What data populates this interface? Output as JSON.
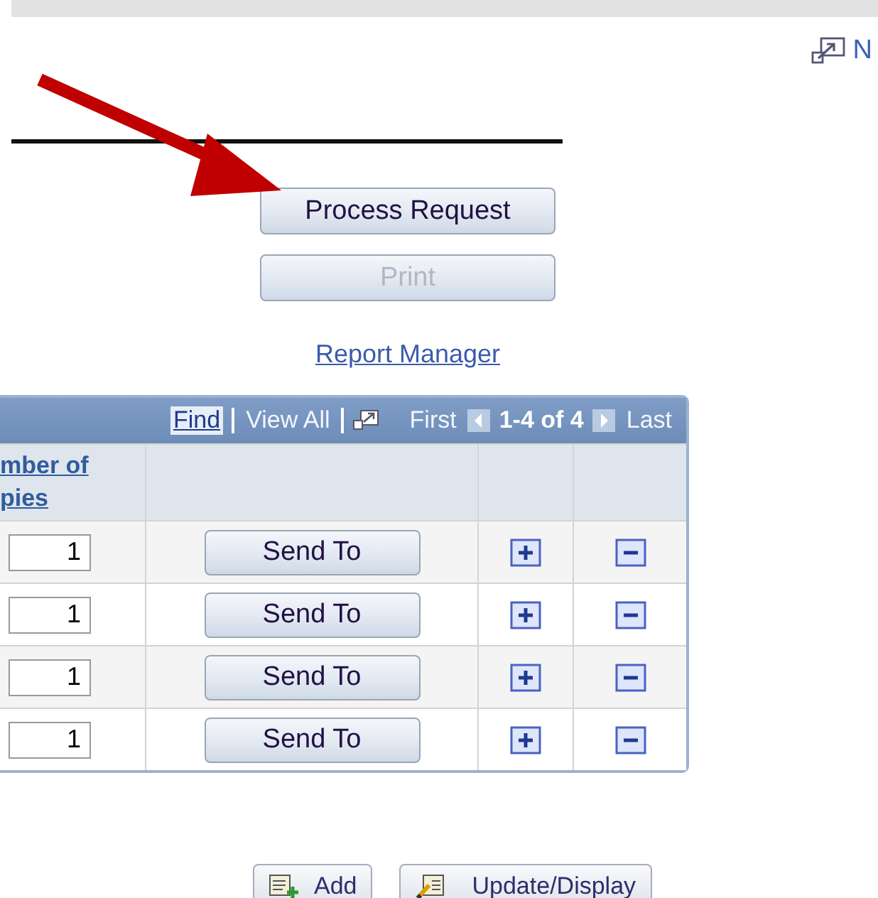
{
  "new_window_link": "N",
  "buttons": [
    {
      "label": "Process Request",
      "disabled": false
    },
    {
      "label": "Print",
      "disabled": true
    }
  ],
  "report_manager_link": "Report Manager",
  "grid": {
    "nav": [
      {
        "kind": "link",
        "label": "Find",
        "disabled": false
      },
      {
        "kind": "link",
        "label": "View All",
        "disabled": true
      },
      {
        "kind": "icon"
      },
      {
        "kind": "link",
        "label": "First",
        "disabled": true
      },
      {
        "kind": "prev",
        "disabled": false
      },
      {
        "kind": "range",
        "label": "1-4 of 4"
      },
      {
        "kind": "next",
        "disabled": false
      },
      {
        "kind": "link",
        "label": "Last",
        "disabled": true
      }
    ],
    "column_header": "mber of pies",
    "rows": [
      {
        "copies": "1",
        "action": "Send To"
      },
      {
        "copies": "1",
        "action": "Send To"
      },
      {
        "copies": "1",
        "action": "Send To"
      },
      {
        "copies": "1",
        "action": "Send To"
      }
    ]
  },
  "footer_buttons": [
    {
      "kind": "add",
      "label": "Add"
    },
    {
      "kind": "update",
      "label": "Update/Display"
    }
  ]
}
